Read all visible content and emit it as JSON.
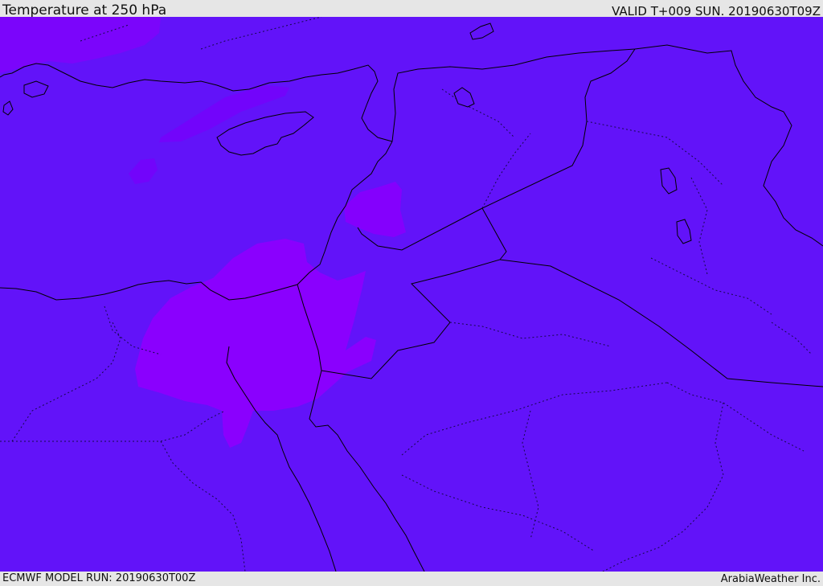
{
  "map": {
    "title": "Temperature at 250 hPa",
    "valid_time": "VALID T+009 SUN. 20190630T09Z",
    "model_run": "ECMWF MODEL RUN: 20190630T00Z",
    "credit": "ArabiaWeather Inc."
  },
  "colors": {
    "background_field": "#6213f9",
    "warm_patch": "#7b05fb",
    "warmer_patch": "#8a00fe",
    "coastline": "#000000",
    "boundary": "#1a0a3a"
  }
}
